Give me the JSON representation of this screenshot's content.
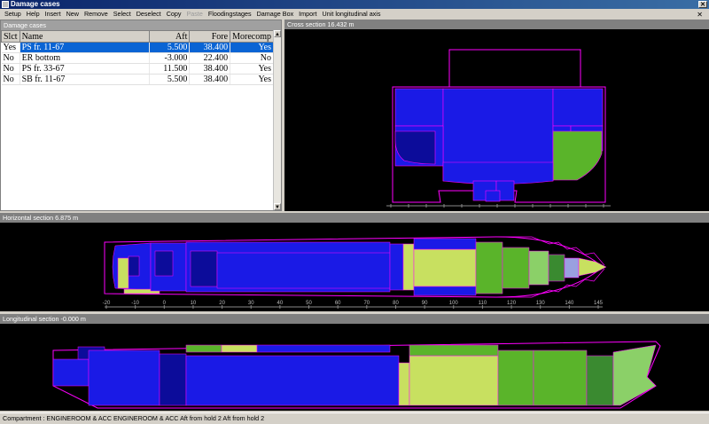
{
  "window": {
    "title": "Damage cases"
  },
  "menu": [
    {
      "label": "Setup",
      "enabled": true
    },
    {
      "label": "Help",
      "enabled": true
    },
    {
      "label": "Insert",
      "enabled": true
    },
    {
      "label": "New",
      "enabled": true
    },
    {
      "label": "Remove",
      "enabled": true
    },
    {
      "label": "Select",
      "enabled": true
    },
    {
      "label": "Deselect",
      "enabled": true
    },
    {
      "label": "Copy",
      "enabled": true
    },
    {
      "label": "Paste",
      "enabled": false
    },
    {
      "label": "Floodingstages",
      "enabled": true
    },
    {
      "label": "Damage Box",
      "enabled": true
    },
    {
      "label": "Import",
      "enabled": true
    },
    {
      "label": "Unit longitudinal axis",
      "enabled": true
    }
  ],
  "damage_cases": {
    "title": "Damage cases",
    "columns": [
      "Slct",
      "Name",
      "Aft",
      "Fore",
      "Morecomp"
    ],
    "rows": [
      {
        "slct": "Yes",
        "name": "PS fr. 11-67",
        "aft": "5.500",
        "fore": "38.400",
        "morecomp": "Yes",
        "selected": true
      },
      {
        "slct": "No",
        "name": "ER bottom",
        "aft": "-3.000",
        "fore": "22.400",
        "morecomp": "No",
        "selected": false
      },
      {
        "slct": "No",
        "name": "PS fr. 33-67",
        "aft": "11.500",
        "fore": "38.400",
        "morecomp": "Yes",
        "selected": false
      },
      {
        "slct": "No",
        "name": "SB fr. 11-67",
        "aft": "5.500",
        "fore": "38.400",
        "morecomp": "Yes",
        "selected": false
      }
    ]
  },
  "cross_section": {
    "title": "Cross section 16.432 m"
  },
  "horizontal_section": {
    "title": "Horizontal section 6.875 m",
    "axis_ticks": [
      "-20",
      "-10",
      "0",
      "10",
      "20",
      "30",
      "40",
      "50",
      "60",
      "70",
      "80",
      "90",
      "100",
      "110",
      "120",
      "130",
      "140",
      "145"
    ]
  },
  "longitudinal_section": {
    "title": "Longitudinal section -0.000 m"
  },
  "status": {
    "text": "Compartment : ENGINEROOM & ACC ENGINEROOM & ACC Aft from hold 2 Aft from hold 2"
  },
  "colors": {
    "blue": "#1a1ae6",
    "lightgreen": "#c8e060",
    "green": "#5ab42a",
    "hull_outline": "#ff00ff",
    "selection": "#0a64d4"
  }
}
